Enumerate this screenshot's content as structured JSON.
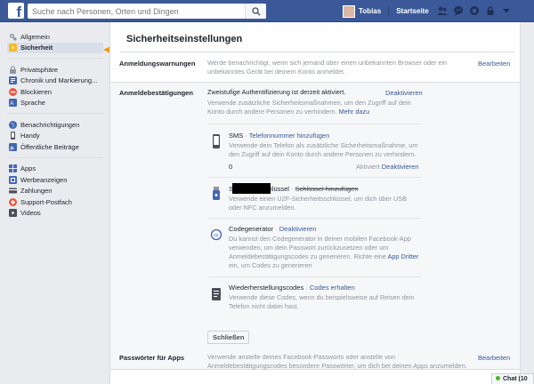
{
  "topbar": {
    "logo": "f",
    "search_placeholder": "Suche nach Personen, Orten und Dingen",
    "user_name": "Tobias",
    "home_label": "Startseite",
    "icons": [
      "friends-icon",
      "messages-icon",
      "notifications-icon",
      "privacy-icon",
      "account-menu-icon"
    ]
  },
  "sidebar": {
    "groups": [
      [
        {
          "label": "Allgemein",
          "icon": "gear-icon",
          "color": "#8d949e"
        },
        {
          "label": "Sicherheit",
          "icon": "shield-icon",
          "color": "#f7b928",
          "active": true
        }
      ],
      [
        {
          "label": "Privatsphäre",
          "icon": "lock-icon",
          "color": "#8d949e"
        },
        {
          "label": "Chronik und Markierung...",
          "icon": "timeline-icon",
          "color": "#4267b2"
        },
        {
          "label": "Blockieren",
          "icon": "block-icon",
          "color": "#e9573f"
        },
        {
          "label": "Sprache",
          "icon": "language-icon",
          "color": "#4267b2"
        }
      ],
      [
        {
          "label": "Benachrichtigungen",
          "icon": "globe-icon",
          "color": "#4267b2"
        },
        {
          "label": "Handy",
          "icon": "phone-icon",
          "color": "#4b4f56"
        },
        {
          "label": "Öffentliche Beiträge",
          "icon": "rss-icon",
          "color": "#4267b2"
        }
      ],
      [
        {
          "label": "Apps",
          "icon": "apps-icon",
          "color": "#4267b2"
        },
        {
          "label": "Werbeanzeigen",
          "icon": "ads-icon",
          "color": "#4267b2"
        },
        {
          "label": "Zahlungen",
          "icon": "payments-icon",
          "color": "#4b4f56"
        },
        {
          "label": "Support-Postfach",
          "icon": "support-icon",
          "color": "#e9573f"
        },
        {
          "label": "Videos",
          "icon": "video-icon",
          "color": "#4b4f56"
        }
      ]
    ]
  },
  "main": {
    "title": "Sicherheitseinstellungen",
    "login_warnings": {
      "label": "Anmeldungswarnungen",
      "desc": "Werde benachrichtigt, wenn sich jemand über einen unbekannten Browser oder ein unbekanntes Gerät bei deinem Konto anmeldet.",
      "edit": "Bearbeiten"
    },
    "login_approvals": {
      "label": "Anmeldebestätigungen",
      "status": "Zweistufige Authentifizierung ist derzeit aktiviert.",
      "deactivate": "Deaktivieren",
      "desc": "Verwende zusätzliche Sicherheitsmaßnahmen, um den Zugriff auf dein Konto durch andere Personen zu verhindern.",
      "more": "Mehr dazu",
      "sms": {
        "title": "SMS",
        "sep": " · ",
        "action": "Telefonnummer hinzufügen",
        "desc": "Verwende dein Telefon als zusätzliche Sicherheitsmaßnahme, um den Zugriff auf dein Konto durch andere Personen zu verhindern.",
        "phone_prefix": "0",
        "status": "Aktiviert",
        "deactivate": "Deaktivieren"
      },
      "security_key": {
        "title": "Sicherheitsschlüssel",
        "sep": " · ",
        "action": "Schlüssel hinzufügen",
        "desc": "Verwende einen U2F-Sicherheitsschlüssel, um dich über USB oder NFC anzumelden."
      },
      "code_generator": {
        "title": "Codegenerator",
        "sep": " · ",
        "action": "Deaktivieren",
        "desc": "Du kannst den Codegenerator in deiner mobilen Facebook-App verwenden, um dein Passwort zurückzusetzen oder um Anmeldebestätigungscodes zu generieren. Richte eine",
        "link": "App Dritter",
        "desc_end": "ein, um Codes zu generieren"
      },
      "recovery_codes": {
        "title": "Wiederherstellungscodes",
        "sep": " · ",
        "action": "Codes erhalten",
        "desc": "Verwende diese Codes, wenn du beispielsweise auf Reisen dein Telefon nicht dabei hast."
      },
      "close": "Schließen"
    },
    "app_passwords": {
      "label": "Passwörter für Apps",
      "desc": "Verwende anstelle deines Facebook-Passworts oder anstelle von Anmeldebestätigungscodes besondere Passwörter, um dich bei deinen Apps anzumelden.",
      "edit": "Bearbeiten"
    }
  },
  "chat": {
    "label": "Chat (10"
  },
  "colors": {
    "brand": "#3b5998",
    "link": "#365899",
    "arrow": "#f39c12"
  }
}
